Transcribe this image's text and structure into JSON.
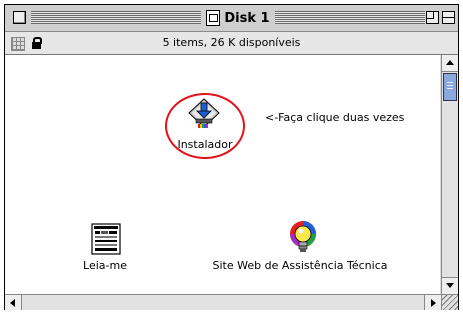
{
  "window": {
    "title": "Disk 1",
    "info": "5 items, 26 K disponíveis"
  },
  "items": {
    "instalador": {
      "label": "Instalador"
    },
    "arrow_note": "<-Faça clique duas vezes",
    "leiame": {
      "label": "Leia-me"
    },
    "site": {
      "label": "Site Web de Assistência Técnica"
    }
  },
  "colors": {
    "highlight_circle": "#e0151b",
    "scroll_thumb": "#8aa8e0"
  },
  "icons": {
    "title": "disk-icon",
    "instalador": "installer-icon",
    "leiame": "document-icon",
    "site": "lightbulb-icon"
  }
}
